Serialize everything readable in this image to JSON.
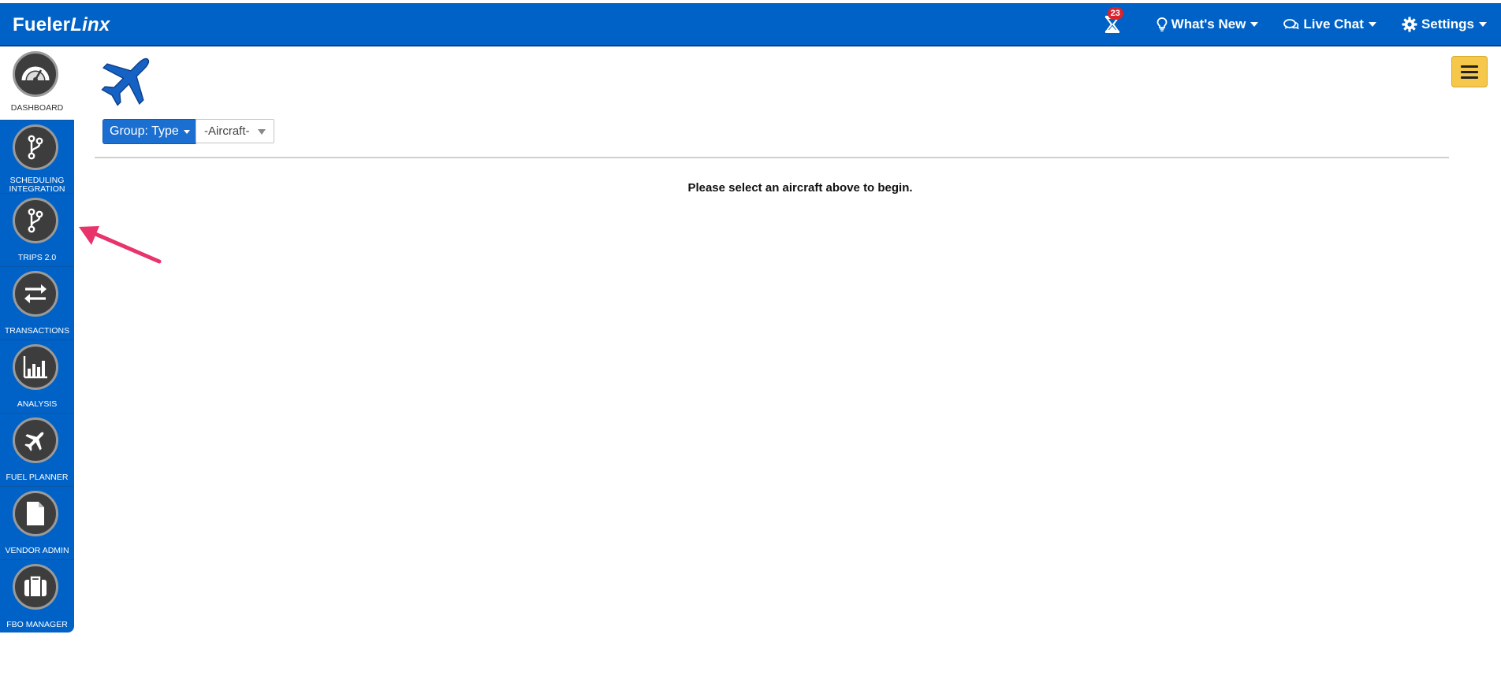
{
  "topbar": {
    "brand_main": "Fueler",
    "brand_italic": "Linx",
    "notification_count": "23",
    "whats_new": "What's New",
    "live_chat": "Live Chat",
    "settings": "Settings"
  },
  "sidebar": {
    "items": [
      {
        "label": "DASHBOARD",
        "icon": "gauge-icon"
      },
      {
        "label": "SCHEDULING INTEGRATION",
        "icon": "branch-icon"
      },
      {
        "label": "TRIPS 2.0",
        "icon": "branch-icon"
      },
      {
        "label": "TRANSACTIONS",
        "icon": "swap-arrows-icon"
      },
      {
        "label": "ANALYSIS",
        "icon": "bar-chart-icon"
      },
      {
        "label": "FUEL PLANNER",
        "icon": "airplane-icon"
      },
      {
        "label": "VENDOR ADMIN",
        "icon": "document-icon"
      },
      {
        "label": "FBO MANAGER",
        "icon": "briefcase-icon"
      }
    ]
  },
  "main": {
    "group_button": "Group: Type",
    "aircraft_select": "-Aircraft-",
    "prompt": "Please select an aircraft above to begin."
  },
  "colors": {
    "primary": "#0062c6",
    "menu_button": "#f5c74a",
    "badge": "#d9232d",
    "annotation_arrow": "#e8336b"
  }
}
